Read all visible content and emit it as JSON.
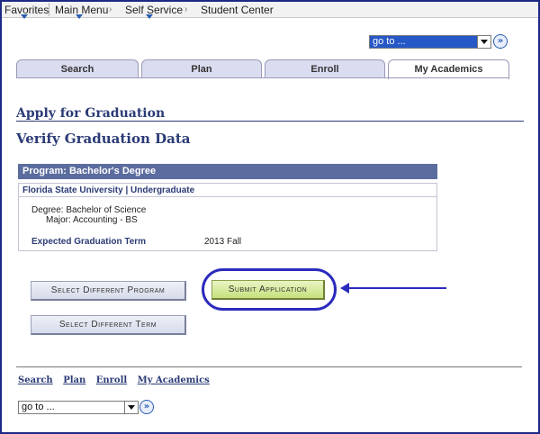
{
  "menu": {
    "favorites": "Favorites",
    "main_menu": "Main Menu",
    "self_service": "Self Service",
    "student_center": "Student Center"
  },
  "goto": {
    "top_value": "go to ...",
    "bottom_value": "go to ...",
    "go_icon": "double-chevron-right-icon"
  },
  "tabs": [
    {
      "label": "Search"
    },
    {
      "label": "Plan"
    },
    {
      "label": "Enroll"
    },
    {
      "label": "My Academics",
      "active": true
    }
  ],
  "page": {
    "title": "Apply for Graduation",
    "subtitle": "Verify Graduation Data"
  },
  "program": {
    "header": "Program: Bachelor's Degree",
    "institution": "Florida State University | Undergraduate",
    "degree": "Degree: Bachelor of Science",
    "major": "Major: Accounting - BS",
    "term_label": "Expected Graduation Term",
    "term_value": "2013 Fall"
  },
  "buttons": {
    "select_program": "Select Different Program",
    "submit": "Submit Application",
    "select_term": "Select Different Term"
  },
  "footer": {
    "links": [
      "Search",
      "Plan",
      "Enroll",
      "My Academics"
    ]
  },
  "colors": {
    "heading": "#2b3b76",
    "annotation": "#2b2bbd",
    "submit_green": "#c6e07c"
  }
}
